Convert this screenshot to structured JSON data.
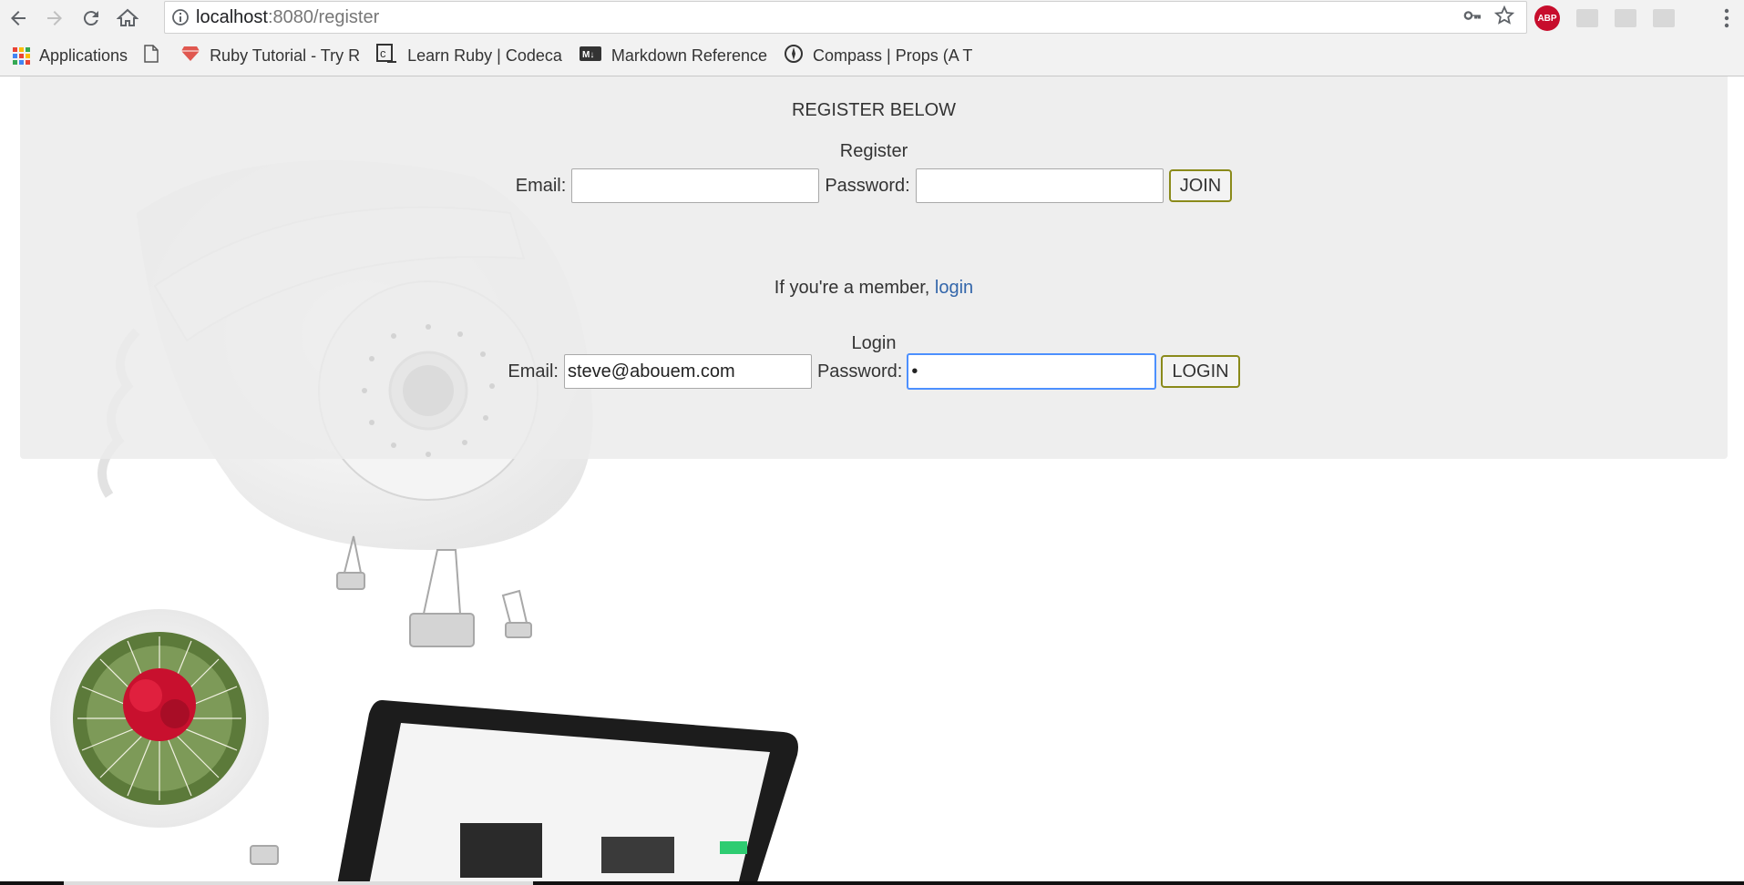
{
  "browser": {
    "url_host": "localhost",
    "url_rest": ":8080/register",
    "extension_abp": "ABP",
    "bookmarks": [
      {
        "label": "Applications"
      },
      {
        "label": "Ruby Tutorial - Try R"
      },
      {
        "label": "Learn Ruby | Codeca"
      },
      {
        "label": "Markdown Reference"
      },
      {
        "label": "Compass | Props (A T"
      }
    ]
  },
  "page": {
    "title": "REGISTER BELOW",
    "register": {
      "heading": "Register",
      "email_label": "Email:",
      "email_value": "",
      "password_label": "Password:",
      "password_value": "",
      "button": "JOIN"
    },
    "member_text": "If you're a member,",
    "member_link": "login",
    "login": {
      "heading": "Login",
      "email_label": "Email:",
      "email_value": "steve@abouem.com",
      "password_label": "Password:",
      "password_value": "•",
      "button": "LOGIN"
    }
  },
  "colors": {
    "link": "#3366aa",
    "button_border": "#8a8a1a",
    "focus": "#4d90fe"
  }
}
